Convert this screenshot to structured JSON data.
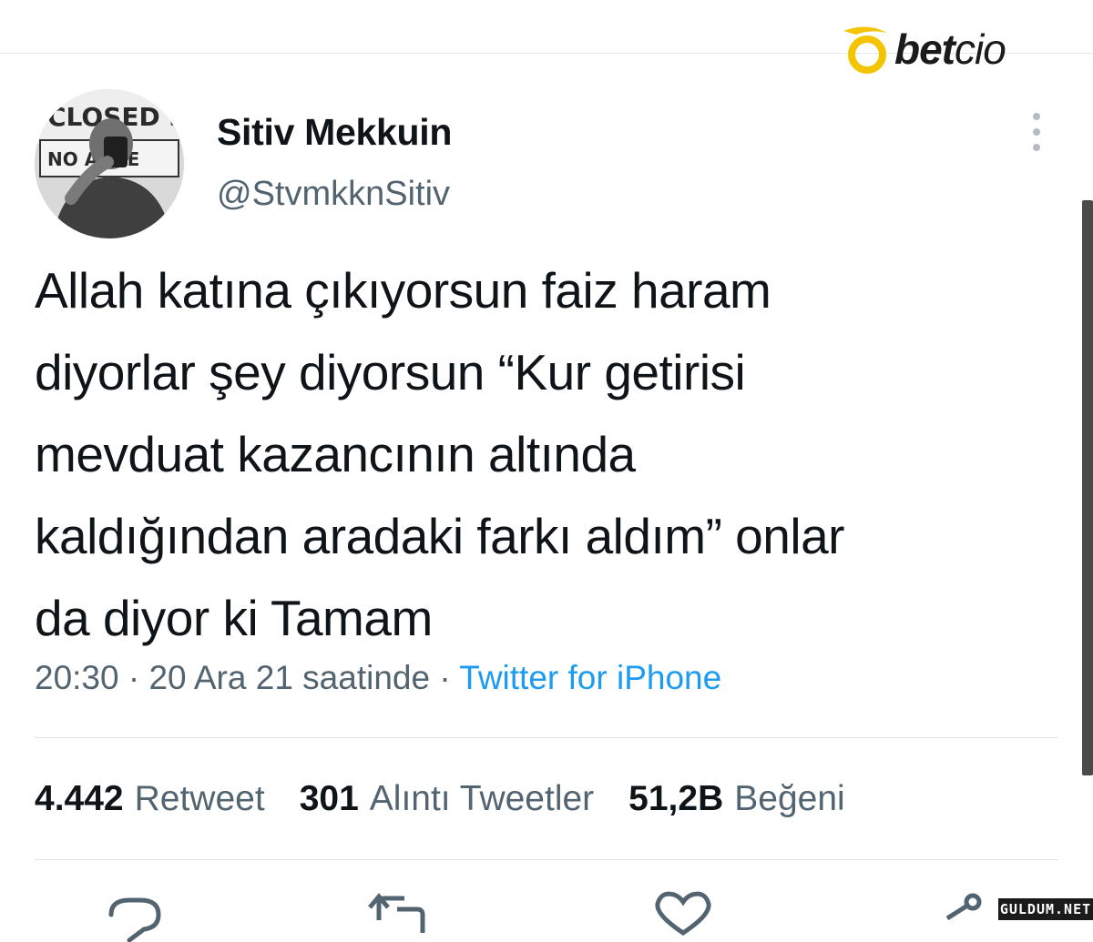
{
  "brand": {
    "logo_text_bold": "bet",
    "logo_text_light": "cio",
    "accent": "#f5c400"
  },
  "tweet": {
    "display_name": "Sitiv Mekkuin",
    "handle": "@StvmkknSitiv",
    "avatar_sign_text_top": "CLOSED SE",
    "avatar_sign_text_bottom": "NO ANCE",
    "more_icon": "more-vertical-icon",
    "text": "Allah katına çıkıyorsun faiz haram\ndiyorlar şey diyorsun “Kur getirisi\nmevduat kazancının altında\nkaldığından aradaki farkı aldım” onlar\nda diyor ki Tamam",
    "time": "20:30",
    "separator": " · ",
    "date": "20 Ara 21 saatinde",
    "source": "Twitter for iPhone",
    "link_color": "#1d9bf0"
  },
  "stats": [
    {
      "count": "4.442",
      "label": "Retweet"
    },
    {
      "count": "301",
      "label": "Alıntı Tweetler"
    },
    {
      "count": "51,2B",
      "label": "Beğeni"
    }
  ],
  "actions": [
    "reply-icon",
    "retweet-icon",
    "like-icon",
    "share-icon"
  ],
  "watermark": "GULDUM.NET"
}
